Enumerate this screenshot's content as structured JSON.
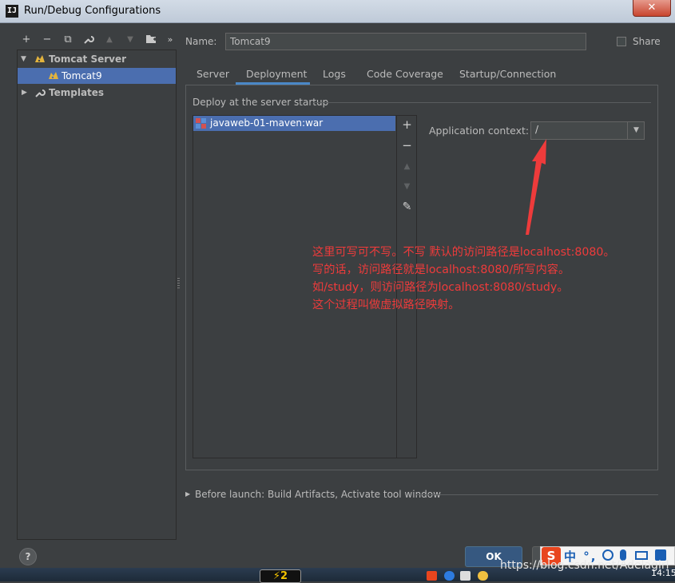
{
  "window": {
    "title": "Run/Debug Configurations",
    "app_logo_text": "IJ",
    "close_glyph": "✕"
  },
  "left_toolbar": {
    "icons": [
      {
        "name": "add-icon",
        "glyph": "+"
      },
      {
        "name": "remove-icon",
        "glyph": "−"
      },
      {
        "name": "copy-icon",
        "glyph": "⧉"
      },
      {
        "name": "wrench-icon",
        "glyph": "🔧"
      },
      {
        "name": "move-up-icon",
        "glyph": "▲"
      },
      {
        "name": "move-down-icon",
        "glyph": "▼"
      },
      {
        "name": "folder-icon",
        "glyph": "▣"
      },
      {
        "name": "more-icon",
        "glyph": "»"
      }
    ]
  },
  "tree": {
    "items": [
      {
        "label": "Tomcat Server",
        "level": 0,
        "expanded": true
      },
      {
        "label": "Tomcat9",
        "level": 1,
        "selected": true
      },
      {
        "label": "Templates",
        "level": 0,
        "expanded": false
      }
    ]
  },
  "name_field": {
    "label": "Name:",
    "value": "Tomcat9"
  },
  "share": {
    "label": "Share",
    "checked": false
  },
  "tabs": [
    "Server",
    "Deployment",
    "Logs",
    "Code Coverage",
    "Startup/Connection"
  ],
  "active_tab": "Deployment",
  "deployment": {
    "group_title": "Deploy at the server startup",
    "artifacts": [
      "javaweb-01-maven:war"
    ],
    "list_buttons": {
      "add": "+",
      "remove": "−",
      "up": "▲",
      "down": "▼",
      "edit": "✎"
    },
    "context_label": "Application context:",
    "context_value": "/",
    "combo_arrow": "▼"
  },
  "annotation": {
    "lines": [
      "这里可写可不写。不写 默认的访问路径是localhost:8080。",
      "写的话，访问路径就是localhost:8080/所写内容。",
      "如/study，则访问路径为localhost:8080/study。",
      "这个过程叫做虚拟路径映射。"
    ],
    "color": "#ee3b3b"
  },
  "before_launch": {
    "text": "Before launch: Build Artifacts, Activate tool window"
  },
  "buttons": {
    "help": "?",
    "ok": "OK"
  },
  "taskbar": {
    "app_badge": "⚡2",
    "ime_logo": "S",
    "ime_text": "中 °,",
    "watermark": "https://blog.csdn.net/Adelagirl",
    "clock": "14:15"
  },
  "colors": {
    "accent": "#4b6eaf",
    "tab_underline": "#4a88c7",
    "background": "#3c3f41"
  }
}
